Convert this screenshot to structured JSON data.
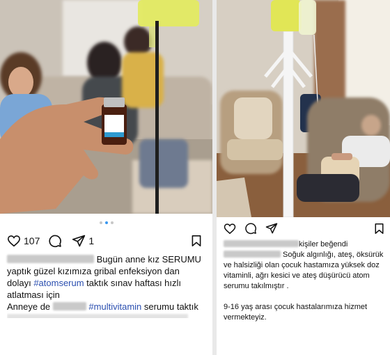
{
  "left_post": {
    "likes": "107",
    "shares": "1",
    "caption": {
      "line1": "Bugün anne kız SERUMU",
      "line2": "yaptık güzel kızımıza gribal enfeksiyon dan",
      "line3_pre": "dolayı ",
      "hashtag1": "#atomserum",
      "line3_post": " taktık sınav haftası hızlı",
      "line4": "atlatması için",
      "line5_pre": "Anneye de ",
      "hashtag2": "#multivitamin",
      "line5_post": " serumu taktık"
    }
  },
  "right_post": {
    "liked_by": "kişiler beğendi",
    "caption": {
      "line1_post": " Soğuk algınlığı, ateş, öksürük",
      "line2": "ve halsizliği olan çocuk hastamıza yüksek doz",
      "line3": "vitaminli, ağrı kesici ve ateş düşürücü atom",
      "line4": "serumu takılmıştır .",
      "line5": "9-16 yaş arası çocuk hastalarımıza hizmet",
      "line6": "vermekteyiz."
    }
  },
  "icons": [
    "heart-icon",
    "comment-icon",
    "share-icon",
    "bookmark-icon"
  ],
  "colors": {
    "hashtag": "#2b4fb0",
    "active_dot": "#3897f0"
  }
}
